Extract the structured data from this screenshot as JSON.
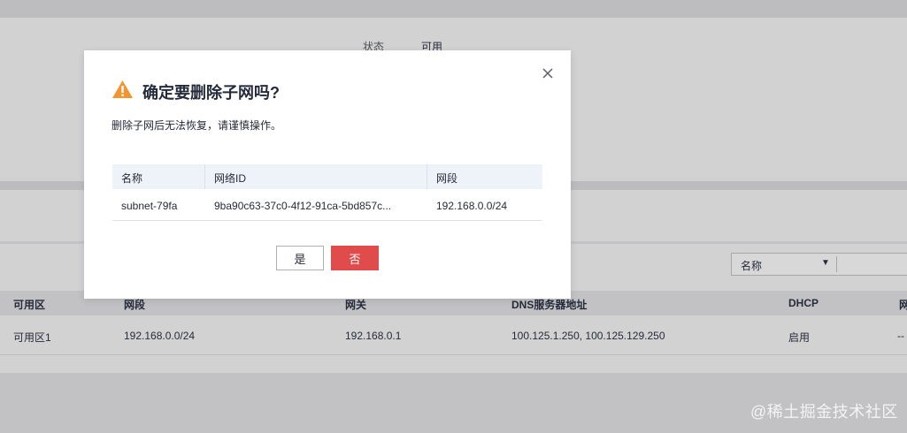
{
  "background": {
    "status_label": "状态",
    "status_value": "可用",
    "filter_select": "名称",
    "table": {
      "headers": [
        "可用区",
        "网段",
        "网关",
        "DNS服务器地址",
        "DHCP",
        "网"
      ],
      "row": [
        "可用区1",
        "192.168.0.0/24",
        "192.168.0.1",
        "100.125.1.250, 100.125.129.250",
        "启用",
        "--"
      ]
    }
  },
  "dialog": {
    "title": "确定要删除子网吗?",
    "description": "删除子网后无法恢复，请谨慎操作。",
    "table": {
      "headers": [
        "名称",
        "网络ID",
        "网段"
      ],
      "row": [
        "subnet-79fa",
        "9ba90c63-37c0-4f12-91ca-5bd857c...",
        "192.168.0.0/24"
      ]
    },
    "yes_label": "是",
    "no_label": "否",
    "colors": {
      "warning": "#f29430",
      "danger": "#e04c4c"
    },
    "icons": [
      "warning-icon",
      "close-icon"
    ]
  },
  "watermark": "@稀土掘金技术社区"
}
